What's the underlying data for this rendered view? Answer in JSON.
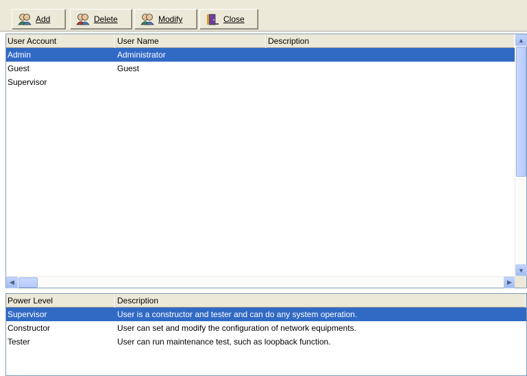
{
  "toolbar": {
    "buttons": [
      {
        "label": "Add",
        "icon": "users-add-icon"
      },
      {
        "label": "Delete",
        "icon": "users-delete-icon"
      },
      {
        "label": "Modify",
        "icon": "users-modify-icon"
      },
      {
        "label": "Close",
        "icon": "exit-door-icon"
      }
    ]
  },
  "users_table": {
    "columns": [
      "User Account",
      "User Name",
      "Description"
    ],
    "rows": [
      {
        "account": "Admin",
        "name": "Administrator",
        "description": "",
        "selected": true
      },
      {
        "account": "Guest",
        "name": "Guest",
        "description": "",
        "selected": false
      },
      {
        "account": "Supervisor",
        "name": "",
        "description": "",
        "selected": false
      }
    ]
  },
  "power_table": {
    "columns": [
      "Power Level",
      "Description"
    ],
    "rows": [
      {
        "level": "Supervisor",
        "description": "User is a constructor and tester and can do any system operation.",
        "selected": true
      },
      {
        "level": "Constructor",
        "description": "User can set and modify the configuration of network equipments.",
        "selected": false
      },
      {
        "level": "Tester",
        "description": "User can run maintenance test, such as loopback function.",
        "selected": false
      }
    ]
  },
  "colors": {
    "selection": "#316ac5",
    "toolbar_bg": "#ece9d8"
  }
}
